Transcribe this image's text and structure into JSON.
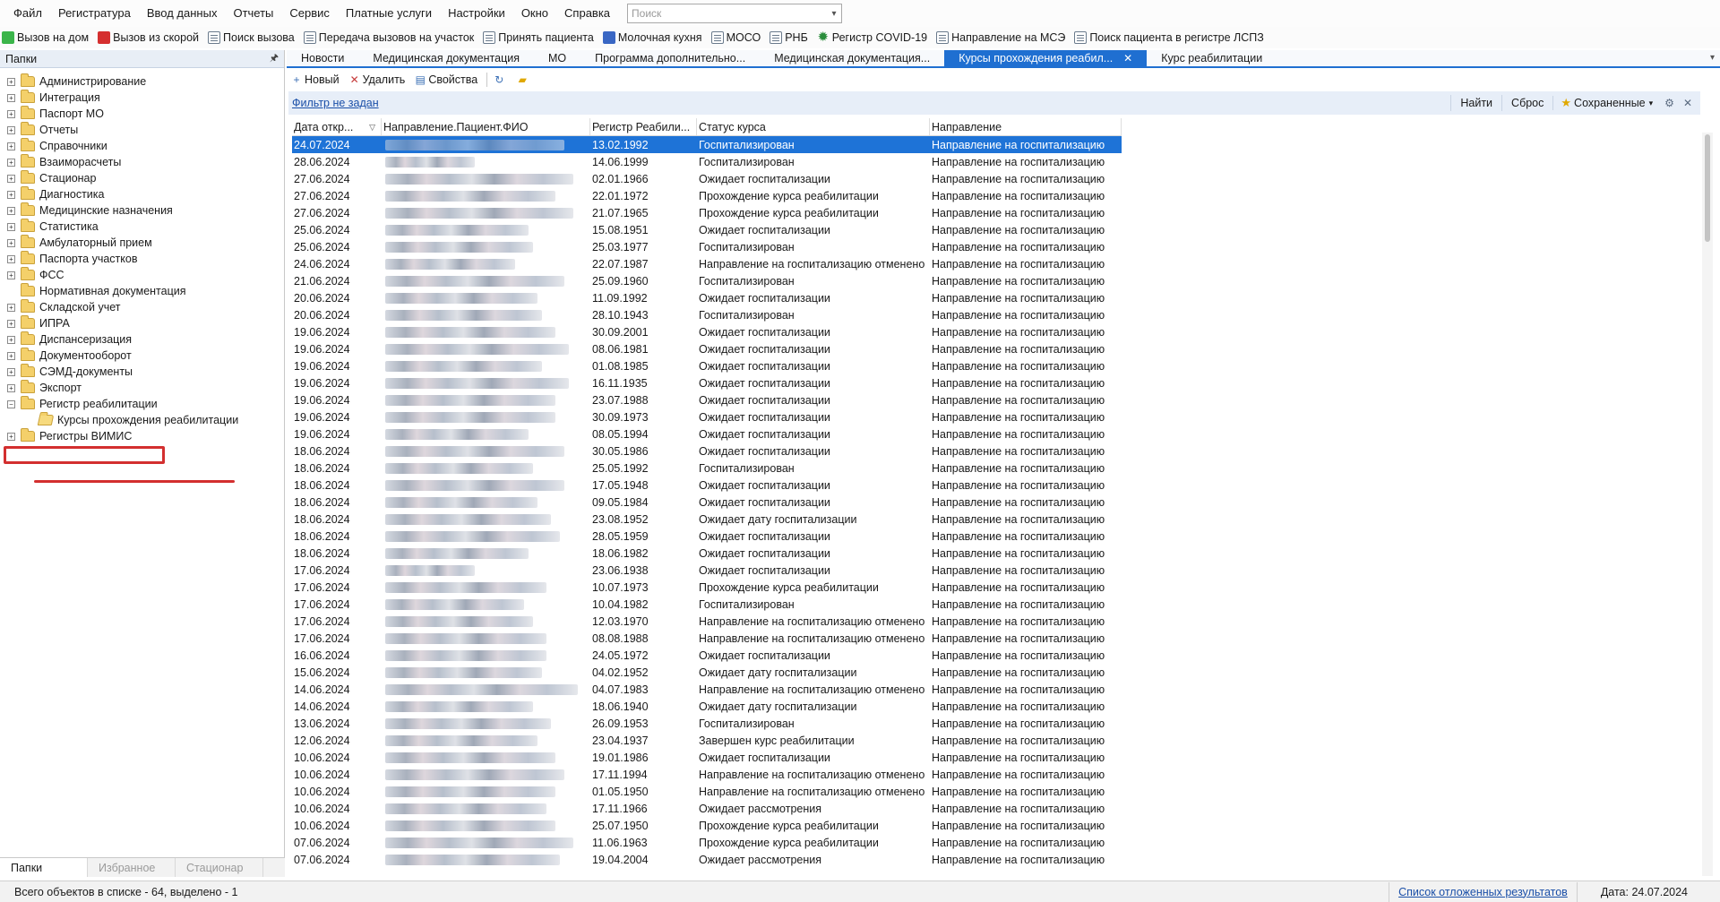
{
  "menu": [
    "Файл",
    "Регистратура",
    "Ввод данных",
    "Отчеты",
    "Сервис",
    "Платные услуги",
    "Настройки",
    "Окно",
    "Справка"
  ],
  "search": {
    "placeholder": "Поиск"
  },
  "quickbar": [
    {
      "label": "Вызов на дом",
      "icon": "green-check-icon"
    },
    {
      "label": "Вызов из скорой",
      "icon": "red-cross-icon"
    },
    {
      "label": "Поиск вызова",
      "icon": "search-doc-icon"
    },
    {
      "label": "Передача вызовов на участок",
      "icon": "transfer-icon"
    },
    {
      "label": "Принять пациента",
      "icon": "doc-icon"
    },
    {
      "label": "Молочная кухня",
      "icon": "bottle-icon"
    },
    {
      "label": "МОСО",
      "icon": "doc-icon"
    },
    {
      "label": "РНБ",
      "icon": "doc-icon"
    },
    {
      "label": "Регистр COVID-19",
      "icon": "virus-icon"
    },
    {
      "label": "Направление на МСЭ",
      "icon": "doc-icon"
    },
    {
      "label": "Поиск пациента в регистре ЛСПЗ",
      "icon": "doc-icon"
    }
  ],
  "leftpanel": {
    "title": "Папки",
    "tree": [
      {
        "label": "Администрирование",
        "exp": "+"
      },
      {
        "label": "Интеграция",
        "exp": "+"
      },
      {
        "label": "Паспорт МО",
        "exp": "+"
      },
      {
        "label": "Отчеты",
        "exp": "+"
      },
      {
        "label": "Справочники",
        "exp": "+"
      },
      {
        "label": "Взаиморасчеты",
        "exp": "+"
      },
      {
        "label": "Стационар",
        "exp": "+"
      },
      {
        "label": "Диагностика",
        "exp": "+"
      },
      {
        "label": "Медицинские назначения",
        "exp": "+"
      },
      {
        "label": "Статистика",
        "exp": "+"
      },
      {
        "label": "Амбулаторный прием",
        "exp": "+"
      },
      {
        "label": "Паспорта участков",
        "exp": "+"
      },
      {
        "label": "ФСС",
        "exp": "+"
      },
      {
        "label": "Нормативная документация",
        "exp": ""
      },
      {
        "label": "Складской учет",
        "exp": "+"
      },
      {
        "label": "ИПРА",
        "exp": "+"
      },
      {
        "label": "Диспансеризация",
        "exp": "+"
      },
      {
        "label": "Документооборот",
        "exp": "+"
      },
      {
        "label": "СЭМД-документы",
        "exp": "+"
      },
      {
        "label": "Экспорт",
        "exp": "+"
      },
      {
        "label": "Регистр реабилитации",
        "exp": "−"
      },
      {
        "label": "Курсы прохождения реабилитации",
        "exp": "",
        "child": true
      },
      {
        "label": "Регистры ВИМИС",
        "exp": "+"
      }
    ],
    "tabs": [
      "Папки",
      "Избранное",
      "Стационар"
    ]
  },
  "doctabs": [
    "Новости",
    "Медицинская документация",
    "МО",
    "Программа дополнительно...",
    "Медицинская документация...",
    "Курсы прохождения реабил...",
    "Курс реабилитации"
  ],
  "active_tab_index": 5,
  "actions": [
    {
      "label": "Новый",
      "sym": "+"
    },
    {
      "label": "Удалить",
      "sym": "✕"
    },
    {
      "label": "Свойства",
      "sym": "▤"
    }
  ],
  "filter": {
    "link": "Фильтр не задан",
    "find": "Найти",
    "reset": "Сброс",
    "saved": "Сохраненные"
  },
  "grid": {
    "columns": [
      "Дата откр...",
      "Направление.Пациент.ФИО",
      "Регистр Реабили...",
      "Статус курса",
      "Направление"
    ],
    "rows": [
      [
        "24.07.2024",
        "13.02.1992",
        "Госпитализирован",
        "Направление на госпитализацию"
      ],
      [
        "28.06.2024",
        "14.06.1999",
        "Госпитализирован",
        "Направление на госпитализацию"
      ],
      [
        "27.06.2024",
        "02.01.1966",
        "Ожидает госпитализации",
        "Направление на госпитализацию"
      ],
      [
        "27.06.2024",
        "22.01.1972",
        "Прохождение курса реабилитации",
        "Направление на госпитализацию"
      ],
      [
        "27.06.2024",
        "21.07.1965",
        "Прохождение курса реабилитации",
        "Направление на госпитализацию"
      ],
      [
        "25.06.2024",
        "15.08.1951",
        "Ожидает госпитализации",
        "Направление на госпитализацию"
      ],
      [
        "25.06.2024",
        "25.03.1977",
        "Госпитализирован",
        "Направление на госпитализацию"
      ],
      [
        "24.06.2024",
        "22.07.1987",
        "Направление на госпитализацию отменено",
        "Направление на госпитализацию"
      ],
      [
        "21.06.2024",
        "25.09.1960",
        "Госпитализирован",
        "Направление на госпитализацию"
      ],
      [
        "20.06.2024",
        "11.09.1992",
        "Ожидает госпитализации",
        "Направление на госпитализацию"
      ],
      [
        "20.06.2024",
        "28.10.1943",
        "Госпитализирован",
        "Направление на госпитализацию"
      ],
      [
        "19.06.2024",
        "30.09.2001",
        "Ожидает госпитализации",
        "Направление на госпитализацию"
      ],
      [
        "19.06.2024",
        "08.06.1981",
        "Ожидает госпитализации",
        "Направление на госпитализацию"
      ],
      [
        "19.06.2024",
        "01.08.1985",
        "Ожидает госпитализации",
        "Направление на госпитализацию"
      ],
      [
        "19.06.2024",
        "16.11.1935",
        "Ожидает госпитализации",
        "Направление на госпитализацию"
      ],
      [
        "19.06.2024",
        "23.07.1988",
        "Ожидает госпитализации",
        "Направление на госпитализацию"
      ],
      [
        "19.06.2024",
        "30.09.1973",
        "Ожидает госпитализации",
        "Направление на госпитализацию"
      ],
      [
        "19.06.2024",
        "08.05.1994",
        "Ожидает госпитализации",
        "Направление на госпитализацию"
      ],
      [
        "18.06.2024",
        "30.05.1986",
        "Ожидает госпитализации",
        "Направление на госпитализацию"
      ],
      [
        "18.06.2024",
        "25.05.1992",
        "Госпитализирован",
        "Направление на госпитализацию"
      ],
      [
        "18.06.2024",
        "17.05.1948",
        "Ожидает госпитализации",
        "Направление на госпитализацию"
      ],
      [
        "18.06.2024",
        "09.05.1984",
        "Ожидает госпитализации",
        "Направление на госпитализацию"
      ],
      [
        "18.06.2024",
        "23.08.1952",
        "Ожидает дату госпитализации",
        "Направление на госпитализацию"
      ],
      [
        "18.06.2024",
        "28.05.1959",
        "Ожидает госпитализации",
        "Направление на госпитализацию"
      ],
      [
        "18.06.2024",
        "18.06.1982",
        "Ожидает госпитализации",
        "Направление на госпитализацию"
      ],
      [
        "17.06.2024",
        "23.06.1938",
        "Ожидает госпитализации",
        "Направление на госпитализацию"
      ],
      [
        "17.06.2024",
        "10.07.1973",
        "Прохождение курса реабилитации",
        "Направление на госпитализацию"
      ],
      [
        "17.06.2024",
        "10.04.1982",
        "Госпитализирован",
        "Направление на госпитализацию"
      ],
      [
        "17.06.2024",
        "12.03.1970",
        "Направление на госпитализацию отменено",
        "Направление на госпитализацию"
      ],
      [
        "17.06.2024",
        "08.08.1988",
        "Направление на госпитализацию отменено",
        "Направление на госпитализацию"
      ],
      [
        "16.06.2024",
        "24.05.1972",
        "Ожидает госпитализации",
        "Направление на госпитализацию"
      ],
      [
        "15.06.2024",
        "04.02.1952",
        "Ожидает дату госпитализации",
        "Направление на госпитализацию"
      ],
      [
        "14.06.2024",
        "04.07.1983",
        "Направление на госпитализацию отменено",
        "Направление на госпитализацию"
      ],
      [
        "14.06.2024",
        "18.06.1940",
        "Ожидает дату госпитализации",
        "Направление на госпитализацию"
      ],
      [
        "13.06.2024",
        "26.09.1953",
        "Госпитализирован",
        "Направление на госпитализацию"
      ],
      [
        "12.06.2024",
        "23.04.1937",
        "Завершен курс реабилитации",
        "Направление на госпитализацию"
      ],
      [
        "10.06.2024",
        "19.01.1986",
        "Ожидает госпитализации",
        "Направление на госпитализацию"
      ],
      [
        "10.06.2024",
        "17.11.1994",
        "Направление на госпитализацию отменено",
        "Направление на госпитализацию"
      ],
      [
        "10.06.2024",
        "01.05.1950",
        "Направление на госпитализацию отменено",
        "Направление на госпитализацию"
      ],
      [
        "10.06.2024",
        "17.11.1966",
        "Ожидает рассмотрения",
        "Направление на госпитализацию"
      ],
      [
        "10.06.2024",
        "25.07.1950",
        "Прохождение курса реабилитации",
        "Направление на госпитализацию"
      ],
      [
        "07.06.2024",
        "11.06.1963",
        "Прохождение курса реабилитации",
        "Направление на госпитализацию"
      ],
      [
        "07.06.2024",
        "19.04.2004",
        "Ожидает рассмотрения",
        "Направление на госпитализацию"
      ]
    ],
    "selected_row": 0
  },
  "status": {
    "left": "Всего объектов в списке - 64, выделено - 1",
    "link": "Список отложенных результатов",
    "date": "Дата: 24.07.2024"
  },
  "colors": {
    "accent": "#1f6fd1",
    "selection": "#1e73d7",
    "highlight": "#d32f2f"
  }
}
